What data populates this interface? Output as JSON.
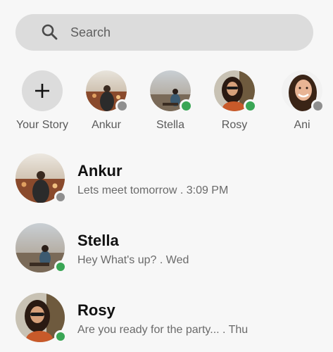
{
  "search": {
    "placeholder": "Search",
    "icon": "search-icon"
  },
  "colors": {
    "online": "#3aa655",
    "offline": "#8f8f8f",
    "search_bg": "#dcdcdc"
  },
  "stories": [
    {
      "label": "Your Story",
      "type": "add"
    },
    {
      "label": "Ankur",
      "status": "offline"
    },
    {
      "label": "Stella",
      "status": "online"
    },
    {
      "label": "Rosy",
      "status": "online"
    },
    {
      "label": "Ani",
      "status": "offline"
    }
  ],
  "chats": [
    {
      "name": "Ankur",
      "message": "Lets meet tomorrow . 3:09 PM",
      "status": "offline"
    },
    {
      "name": "Stella",
      "message": "Hey What's up? . Wed",
      "status": "online"
    },
    {
      "name": "Rosy",
      "message": "Are you ready for the party... . Thu",
      "status": "online"
    }
  ]
}
